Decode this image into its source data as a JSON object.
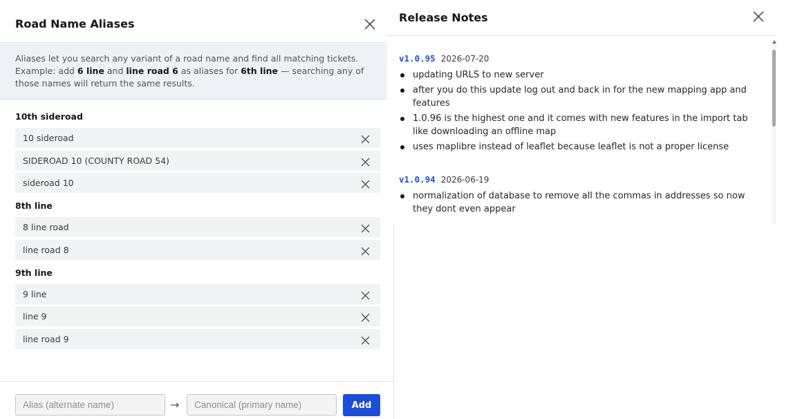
{
  "aliases_dialog": {
    "title": "Road Name Aliases",
    "info": {
      "t1": "Aliases let you search any variant of a road name and find all matching tickets. Example: add ",
      "b1": "6 line",
      "t2": " and ",
      "b2": "line road 6",
      "t3": " as aliases for ",
      "b3": "6th line",
      "t4": " — searching any of those names will return the same results."
    },
    "groups": [
      {
        "title": "10th sideroad",
        "aliases": [
          "10 sideroad",
          "SIDEROAD 10 (COUNTY ROAD 54)",
          "sideroad 10"
        ]
      },
      {
        "title": "8th line",
        "aliases": [
          "8 line road",
          "line road 8"
        ]
      },
      {
        "title": "9th line",
        "aliases": [
          "9 line",
          "line 9",
          "line road 9"
        ]
      }
    ],
    "footer": {
      "alias_placeholder": "Alias (alternate name)",
      "arrow": "→",
      "canonical_placeholder": "Canonical (primary name)",
      "add_label": "Add"
    }
  },
  "release_notes": {
    "title": "Release Notes",
    "releases": [
      {
        "version": "v1.0.95",
        "date": "2026-07-20",
        "notes": [
          "updating URLS to new server",
          "after you do this update log out and back in for the new mapping app and features",
          "1.0.96 is the highest one and it comes with new features in the import tab like downloading an offline map",
          "uses maplibre instead of leaflet because leaflet is not a proper license"
        ]
      },
      {
        "version": "v1.0.94",
        "date": "2026-06-19",
        "notes": [
          "normalization of database to remove all the commas in addresses so now they dont even appear"
        ]
      }
    ]
  },
  "colors": {
    "accent": "#1d4ed8",
    "info_bg": "#eef2f7",
    "row_bg": "#f1f3f5"
  }
}
